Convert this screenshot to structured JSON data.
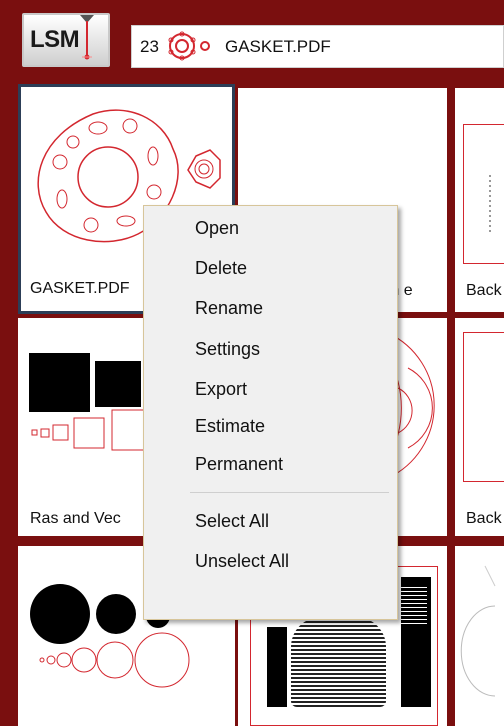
{
  "app": {
    "logo_text": "LSM"
  },
  "address_bar": {
    "count": "23",
    "file_name": "GASKET.PDF"
  },
  "tiles": [
    {
      "label": "GASKET.PDF"
    },
    {
      "label": "m e"
    },
    {
      "label": "Back"
    },
    {
      "label": "Ras and Vec"
    },
    {
      "label": ""
    },
    {
      "label": "Back"
    },
    {
      "label": ""
    },
    {
      "label": ""
    },
    {
      "label": ""
    }
  ],
  "context_menu": {
    "items": [
      "Open",
      "Delete",
      "Rename",
      "Settings",
      "Export",
      "Estimate",
      "Permanent"
    ],
    "items2": [
      "Select All",
      "Unselect All"
    ]
  },
  "colors": {
    "frame": "#7a0f0f",
    "outline_red": "#d3272f",
    "selection": "#2c3e57"
  }
}
